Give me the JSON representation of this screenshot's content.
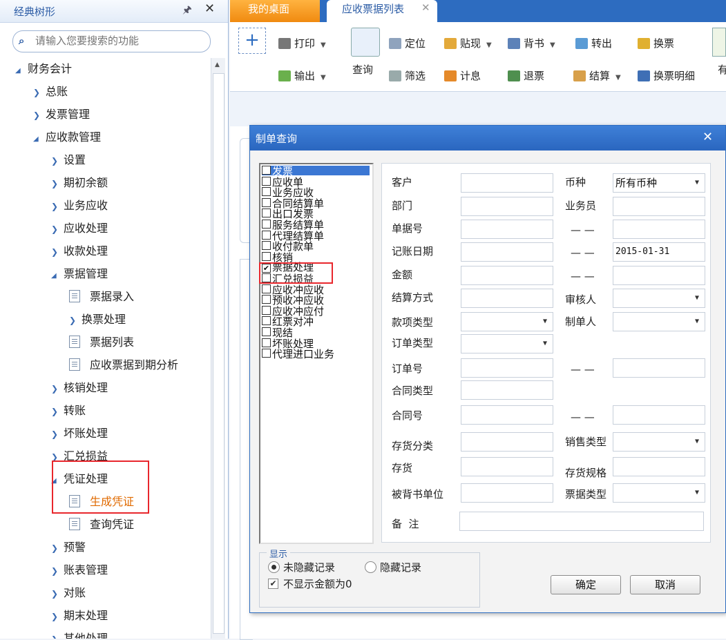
{
  "sidebar": {
    "title": "经典树形",
    "search_placeholder": "请输入您要搜索的功能",
    "tree": [
      {
        "label": "财务会计",
        "level": 0,
        "kind": "expanded"
      },
      {
        "label": "总账",
        "level": 1,
        "kind": "collapsed"
      },
      {
        "label": "发票管理",
        "level": 1,
        "kind": "collapsed"
      },
      {
        "label": "应收款管理",
        "level": 1,
        "kind": "expanded"
      },
      {
        "label": "设置",
        "level": 2,
        "kind": "collapsed"
      },
      {
        "label": "期初余额",
        "level": 2,
        "kind": "collapsed"
      },
      {
        "label": "业务应收",
        "level": 2,
        "kind": "collapsed"
      },
      {
        "label": "应收处理",
        "level": 2,
        "kind": "collapsed"
      },
      {
        "label": "收款处理",
        "level": 2,
        "kind": "collapsed"
      },
      {
        "label": "票据管理",
        "level": 2,
        "kind": "expanded"
      },
      {
        "label": "票据录入",
        "level": 3,
        "kind": "doc"
      },
      {
        "label": "换票处理",
        "level": 3,
        "kind": "collapsed"
      },
      {
        "label": "票据列表",
        "level": 3,
        "kind": "doc"
      },
      {
        "label": "应收票据到期分析",
        "level": 3,
        "kind": "doc"
      },
      {
        "label": "核销处理",
        "level": 2,
        "kind": "collapsed"
      },
      {
        "label": "转账",
        "level": 2,
        "kind": "collapsed"
      },
      {
        "label": "坏账处理",
        "level": 2,
        "kind": "collapsed"
      },
      {
        "label": "汇兑损益",
        "level": 2,
        "kind": "collapsed"
      },
      {
        "label": "凭证处理",
        "level": 2,
        "kind": "expanded"
      },
      {
        "label": "生成凭证",
        "level": 3,
        "kind": "doc",
        "active": true
      },
      {
        "label": "查询凭证",
        "level": 3,
        "kind": "doc"
      },
      {
        "label": "预警",
        "level": 2,
        "kind": "collapsed"
      },
      {
        "label": "账表管理",
        "level": 2,
        "kind": "collapsed"
      },
      {
        "label": "对账",
        "level": 2,
        "kind": "collapsed"
      },
      {
        "label": "期末处理",
        "level": 2,
        "kind": "collapsed"
      },
      {
        "label": "其他处理",
        "level": 2,
        "kind": "collapsed"
      }
    ]
  },
  "tabs": {
    "desk": "我的桌面",
    "list": "应收票据列表"
  },
  "toolbar": {
    "print": "打印",
    "export": "输出",
    "query": "查询",
    "locate": "定位",
    "filter": "筛选",
    "discount": "贴现",
    "interest": "计息",
    "endorse": "背书",
    "return_bill": "退票",
    "transfer_out": "转出",
    "settle": "结算",
    "exchange": "换票",
    "exchange_detail": "换票明细",
    "more": "有"
  },
  "dialog": {
    "title": "制单查询",
    "types": [
      {
        "label": "发票",
        "checked": false,
        "selected": true
      },
      {
        "label": "应收单",
        "checked": false
      },
      {
        "label": "业务应收",
        "checked": false
      },
      {
        "label": "合同结算单",
        "checked": false
      },
      {
        "label": "出口发票",
        "checked": false
      },
      {
        "label": "服务结算单",
        "checked": false
      },
      {
        "label": "代理结算单",
        "checked": false
      },
      {
        "label": "收付款单",
        "checked": false
      },
      {
        "label": "核销",
        "checked": false
      },
      {
        "label": "票据处理",
        "checked": true
      },
      {
        "label": "汇兑损益",
        "checked": false
      },
      {
        "label": "应收冲应收",
        "checked": false
      },
      {
        "label": "预收冲应收",
        "checked": false
      },
      {
        "label": "应收冲应付",
        "checked": false
      },
      {
        "label": "红票对冲",
        "checked": false
      },
      {
        "label": "现结",
        "checked": false
      },
      {
        "label": "坏账处理",
        "checked": false
      },
      {
        "label": "代理进口业务",
        "checked": false
      }
    ],
    "form": {
      "customer": "客户",
      "currency": "币种",
      "currency_value": "所有币种",
      "department": "部门",
      "salesman": "业务员",
      "doc_no": "单据号",
      "range_sep": "— —",
      "post_date": "记账日期",
      "post_date_to": "2015-01-31",
      "amount": "金额",
      "settle_method": "结算方式",
      "auditor": "审核人",
      "payment_type": "款项类型",
      "maker": "制单人",
      "order_type": "订单类型",
      "order_no": "订单号",
      "contract_type": "合同类型",
      "contract_no": "合同号",
      "inventory_class": "存货分类",
      "sales_type": "销售类型",
      "inventory": "存货",
      "inventory_spec": "存货规格",
      "endorsee": "被背书单位",
      "bill_type": "票据类型",
      "remark": "备  注"
    },
    "display": {
      "legend": "显示",
      "unhidden": "未隐藏记录",
      "hidden": "隐藏记录",
      "no_zero": "不显示金额为0"
    },
    "ok": "确定",
    "cancel": "取消"
  }
}
